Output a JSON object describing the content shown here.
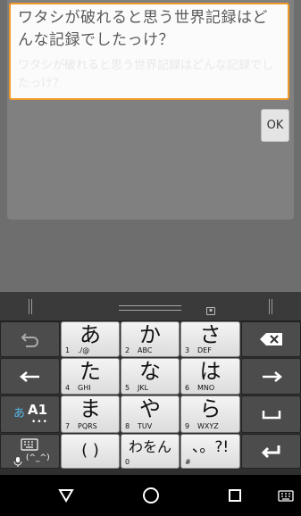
{
  "question": {
    "text": "ワタシが破れると思う世界記録はどんな記録でしたっけ？",
    "answer_faint": "ワタシが破れると思う世界記録はどんな記録でしたっけ？"
  },
  "ok_button": {
    "label": "OK"
  },
  "keyboard": {
    "rows": [
      [
        {
          "main": "あ",
          "sub": "1",
          "sub2": "./@"
        },
        {
          "main": "か",
          "sub": "2",
          "sub2": "ABC"
        },
        {
          "main": "さ",
          "sub": "3",
          "sub2": "DEF"
        }
      ],
      [
        {
          "main": "た",
          "sub": "4",
          "sub2": "GHI"
        },
        {
          "main": "な",
          "sub": "5",
          "sub2": "JKL"
        },
        {
          "main": "は",
          "sub": "6",
          "sub2": "MNO"
        }
      ],
      [
        {
          "main": "ま",
          "sub": "7",
          "sub2": "PQRS"
        },
        {
          "main": "や",
          "sub": "8",
          "sub2": "TUV"
        },
        {
          "main": "ら",
          "sub": "9",
          "sub2": "WXYZ"
        }
      ],
      [
        {
          "main": "( )",
          "sub": "",
          "sub2": ""
        },
        {
          "main": "わをん",
          "sub": "0",
          "sub2": ""
        },
        {
          "main": "、。?!",
          "sub": "#",
          "sub2": ""
        }
      ]
    ],
    "mode_key": {
      "kana": "あ",
      "label": "A1",
      "dots": "•••"
    },
    "emoticon_label": "(^_^)",
    "colors": {
      "mode_accent": "#56b7ea",
      "focus_border": "#f29a28"
    }
  },
  "icons": {
    "undo": "undo-icon",
    "left": "arrow-left-icon",
    "right": "arrow-right-icon",
    "backspace": "backspace-icon",
    "space": "space-icon",
    "enter": "enter-icon",
    "keyboard": "keyboard-icon",
    "microphone": "microphone-icon"
  }
}
